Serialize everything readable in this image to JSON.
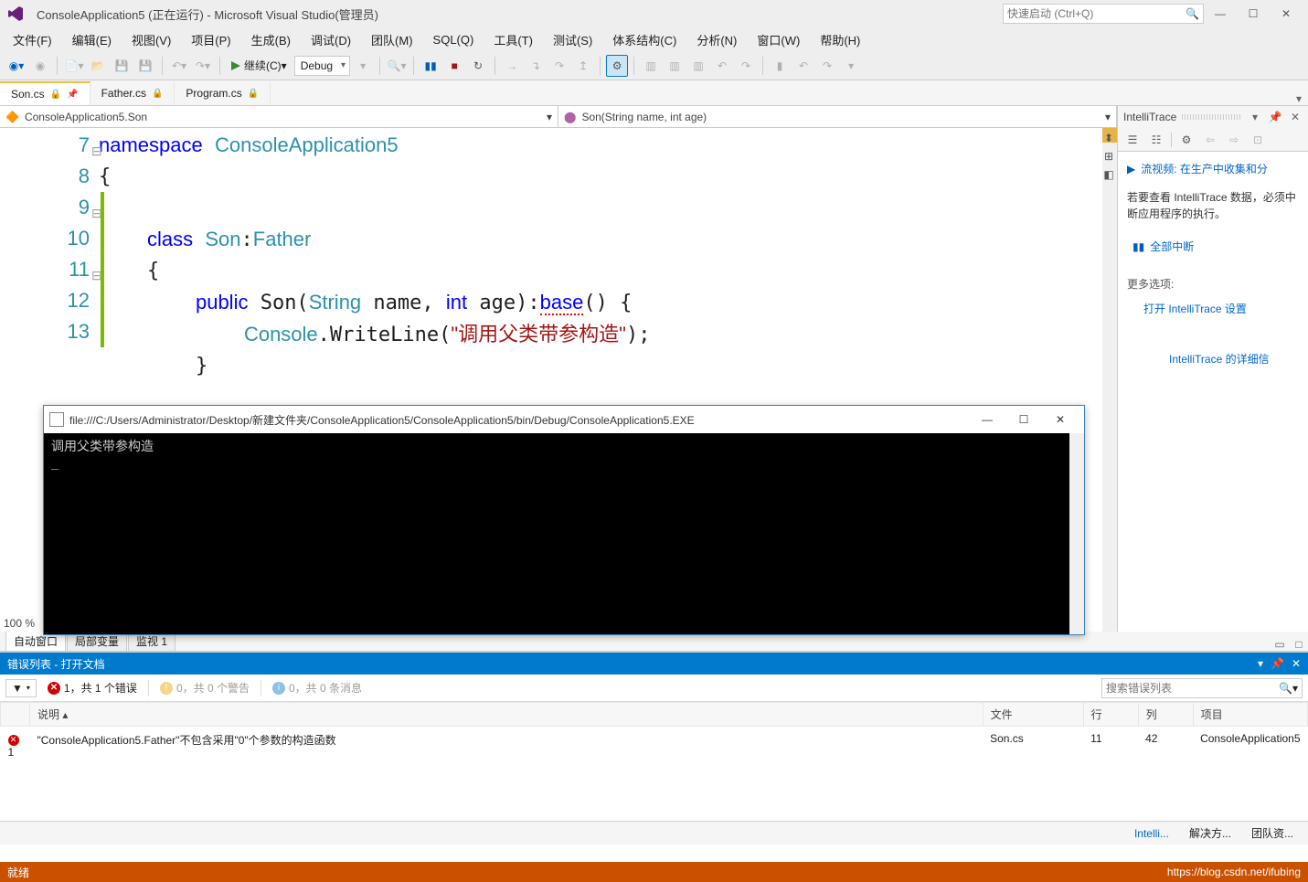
{
  "title": "ConsoleApplication5 (正在运行) - Microsoft Visual Studio(管理员)",
  "search_placeholder": "快速启动 (Ctrl+Q)",
  "menu": [
    "文件(F)",
    "编辑(E)",
    "视图(V)",
    "项目(P)",
    "生成(B)",
    "调试(D)",
    "团队(M)",
    "SQL(Q)",
    "工具(T)",
    "测试(S)",
    "体系结构(C)",
    "分析(N)",
    "窗口(W)",
    "帮助(H)"
  ],
  "toolbar": {
    "continue_label": "继续(C)",
    "config": "Debug"
  },
  "tabs": [
    {
      "label": "Son.cs",
      "active": true,
      "pinned": true,
      "locked": true
    },
    {
      "label": "Father.cs",
      "active": false,
      "locked": true
    },
    {
      "label": "Program.cs",
      "active": false,
      "locked": true
    }
  ],
  "navbar": {
    "left": "ConsoleApplication5.Son",
    "right": "Son(String name, int age)"
  },
  "code_lines": [
    "7",
    "8",
    "9",
    "10",
    "11",
    "12",
    "13"
  ],
  "zoom": "100 %",
  "console": {
    "path": "file:///C:/Users/Administrator/Desktop/新建文件夹/ConsoleApplication5/ConsoleApplication5/bin/Debug/ConsoleApplication5.EXE",
    "output": "调用父类带参构造\n_"
  },
  "intellitrace": {
    "title": "IntelliTrace",
    "video": "流视频: 在生产中收集和分",
    "msg": "若要查看 IntelliTrace 数据，必须中断应用程序的执行。",
    "break_all": "全部中断",
    "more": "更多选项:",
    "open_settings": "打开 IntelliTrace 设置",
    "details": "IntelliTrace 的详细信"
  },
  "bottom_tabs": [
    "自动窗口",
    "局部变量",
    "监视 1"
  ],
  "errorlist": {
    "header": "错误列表 - 打开文档",
    "errors_label": "1，共 1 个错误",
    "warnings_label": "0，共 0 个警告",
    "messages_label": "0，共 0 条消息",
    "search_placeholder": "搜索错误列表",
    "columns": [
      "",
      "说明 ▴",
      "文件",
      "行",
      "列",
      "项目"
    ],
    "rows": [
      {
        "num": "1",
        "desc": "\"ConsoleApplication5.Father\"不包含采用\"0\"个参数的构造函数",
        "file": "Son.cs",
        "line": "11",
        "col": "42",
        "project": "ConsoleApplication5"
      }
    ]
  },
  "right_tabs": [
    "Intelli...",
    "解决方...",
    "团队资..."
  ],
  "status": {
    "left": "就绪",
    "right": "https://blog.csdn.net/ifubing"
  }
}
